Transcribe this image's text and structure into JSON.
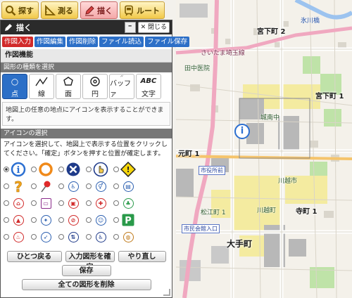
{
  "toolbar": {
    "search": "探す",
    "measure": "測る",
    "draw": "描く",
    "route": "ルート"
  },
  "panel": {
    "title": "描く",
    "close_label": "✕ 閉じる",
    "tabs": [
      "作図入力",
      "作図編集",
      "作図削除",
      "ファイル読込",
      "ファイル保存"
    ],
    "section_function": "作図機能",
    "section_shape_type": "図形の種類を選択",
    "shapes": [
      {
        "label": "点",
        "glyph": "○"
      },
      {
        "label": "線",
        "glyph": "⟋"
      },
      {
        "label": "面",
        "glyph": "⬡"
      },
      {
        "label": "円",
        "glyph": "◎"
      },
      {
        "label": "バッファ",
        "glyph": "⟋"
      },
      {
        "label": "文字",
        "glyph": "ABC"
      }
    ],
    "shape_description": "地図上の任意の地点にアイコンを表示することができます。",
    "section_icon_select": "アイコンの選択",
    "icon_instruction": "アイコンを選択して、地図上で表示する位置をクリックしてください。「確定」ボタンを押すと位置が確定します。",
    "buttons": {
      "undo": "ひとつ戻る",
      "confirm": "入力図形を確定",
      "redo": "やり直し",
      "save": "保存",
      "delete_all": "全ての図形を削除"
    }
  },
  "map_labels": {
    "hikawa": "氷川橋",
    "miyashita2": "宮下町 2",
    "miyashita1": "宮下町 1",
    "motomachi1": "元町 1",
    "teramachi1": "寺町 1",
    "ote": "大手町",
    "station_city_hall": "市役所前",
    "station_ote_gate": "市民会館入口",
    "school": "城南中",
    "river": "川越市",
    "saitama": "さいたま埼玉線",
    "tanakacho": "田中医院",
    "kawagoe": "川越町",
    "matsuecho": "松江町 1"
  },
  "colors": {
    "accent_red": "#d12a2a",
    "tab_blue": "#2c6fc7",
    "toolbar_yellow": "#f2c94a",
    "road_pink": "#f0a8c0"
  }
}
